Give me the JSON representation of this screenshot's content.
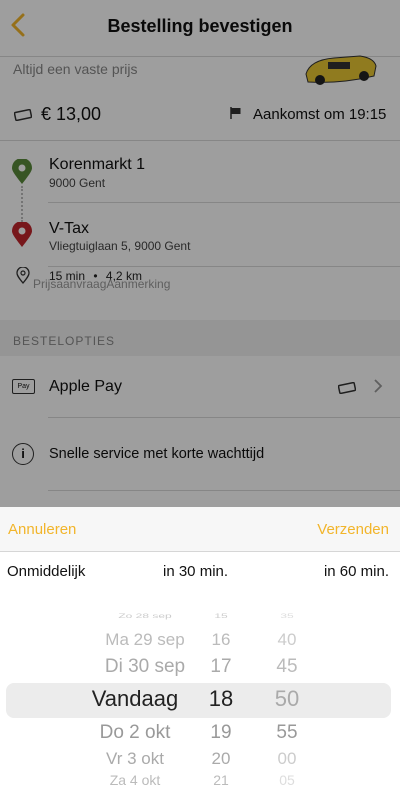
{
  "header": {
    "title": "Bestelling bevestigen",
    "back_icon": "chevron-left-icon"
  },
  "summary": {
    "fixed_price_text": "Altijd een vaste prijs",
    "price": "€ 13,00",
    "arrival": "Aankomst om 19:15"
  },
  "route": {
    "origin_name": "Korenmarkt 1",
    "origin_city": "9000 Gent",
    "dest_name": "V-Tax",
    "dest_address": "Vliegtuiglaan 5, 9000 Gent",
    "duration": "15 min",
    "distance": "4,2 km",
    "overlay_text": "PrijsaanvraagAanmerking"
  },
  "options": {
    "section_label": "BESTELOPTIES",
    "payment_label": "Apple Pay",
    "pay_badge": "Pay",
    "service_label": "Snelle service met korte wachttijd"
  },
  "sheet": {
    "cancel": "Annuleren",
    "submit": "Verzenden",
    "quick": [
      "Onmiddelijk",
      "in 30 min.",
      "in 60 min."
    ]
  },
  "picker": {
    "days": [
      "Zo 28 sep",
      "Ma 29 sep",
      "Di 30 sep",
      "Vandaag",
      "Do 2 okt",
      "Vr 3 okt",
      "Za 4 okt"
    ],
    "hours": [
      "15",
      "16",
      "17",
      "18",
      "19",
      "20",
      "21"
    ],
    "minutes": [
      "35",
      "40",
      "45",
      "50",
      "55",
      "00",
      "05"
    ],
    "selected_day": "Vandaag",
    "selected_hour": "18",
    "selected_minute": "50"
  },
  "colors": {
    "accent": "#f2b52b",
    "origin_pin": "#5a8a3a",
    "dest_pin": "#c0262c"
  }
}
